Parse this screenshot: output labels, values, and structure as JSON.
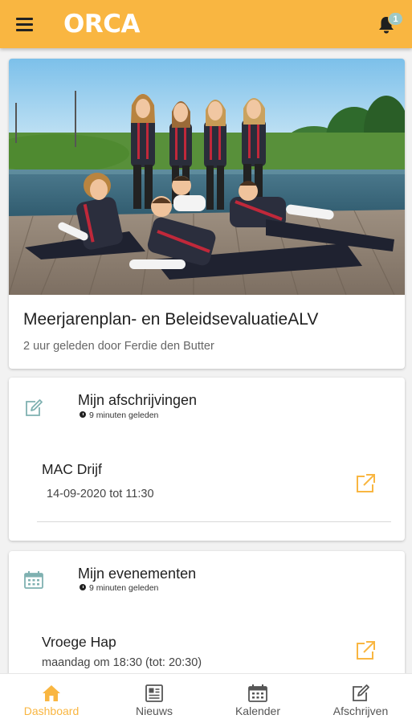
{
  "appbar": {
    "logo": "ORCA",
    "notification_count": "1"
  },
  "news": {
    "title": "Meerjarenplan- en BeleidsevaluatieALV",
    "subtitle": "2 uur geleden door Ferdie den Butter"
  },
  "sections": [
    {
      "title": "Mijn afschrijvingen",
      "time": "9 minuten geleden",
      "item": {
        "title": "MAC Drijf",
        "subtitle": "14-09-2020 tot 11:30"
      }
    },
    {
      "title": "Mijn evenementen",
      "time": "9 minuten geleden",
      "item": {
        "title": "Vroege Hap",
        "subtitle": "maandag om 18:30 (tot: 20:30)"
      }
    }
  ],
  "bottom_nav": [
    {
      "label": "Dashboard",
      "icon": "home-icon",
      "active": true
    },
    {
      "label": "Nieuws",
      "icon": "newspaper-icon",
      "active": false
    },
    {
      "label": "Kalender",
      "icon": "calendar-icon",
      "active": false
    },
    {
      "label": "Afschrijven",
      "icon": "edit-icon",
      "active": false
    }
  ],
  "colors": {
    "accent": "#f9b641",
    "icon_teal": "#7fb1b1",
    "background": "#f2f2f2"
  }
}
